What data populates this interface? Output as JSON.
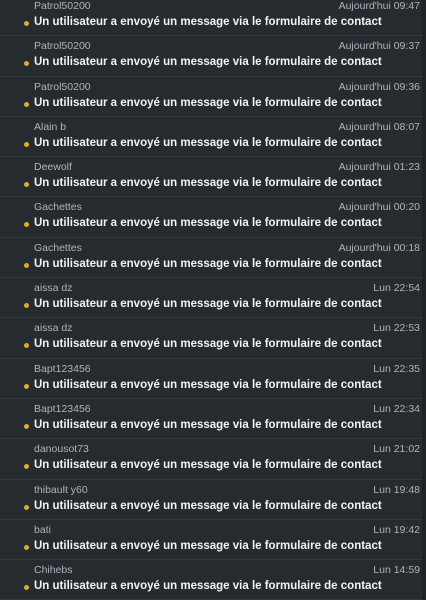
{
  "notifications": [
    {
      "sender": "Patrol50200",
      "time": "Aujourd'hui 09:47",
      "subject": "Un utilisateur a envoyé un message via le formulaire de contact"
    },
    {
      "sender": "Patrol50200",
      "time": "Aujourd'hui 09:37",
      "subject": "Un utilisateur a envoyé un message via le formulaire de contact"
    },
    {
      "sender": "Patrol50200",
      "time": "Aujourd'hui 09:36",
      "subject": "Un utilisateur a envoyé un message via le formulaire de contact"
    },
    {
      "sender": "Alain b",
      "time": "Aujourd'hui 08:07",
      "subject": "Un utilisateur a envoyé un message via le formulaire de contact"
    },
    {
      "sender": "Deewolf",
      "time": "Aujourd'hui 01:23",
      "subject": "Un utilisateur a envoyé un message via le formulaire de contact"
    },
    {
      "sender": "Gachettes",
      "time": "Aujourd'hui 00:20",
      "subject": "Un utilisateur a envoyé un message via le formulaire de contact"
    },
    {
      "sender": "Gachettes",
      "time": "Aujourd'hui 00:18",
      "subject": "Un utilisateur a envoyé un message via le formulaire de contact"
    },
    {
      "sender": "aissa dz",
      "time": "Lun 22:54",
      "subject": "Un utilisateur a envoyé un message via le formulaire de contact"
    },
    {
      "sender": "aissa dz",
      "time": "Lun 22:53",
      "subject": "Un utilisateur a envoyé un message via le formulaire de contact"
    },
    {
      "sender": "Bapt123456",
      "time": "Lun 22:35",
      "subject": "Un utilisateur a envoyé un message via le formulaire de contact"
    },
    {
      "sender": "Bapt123456",
      "time": "Lun 22:34",
      "subject": "Un utilisateur a envoyé un message via le formulaire de contact"
    },
    {
      "sender": "danousot73",
      "time": "Lun 21:02",
      "subject": "Un utilisateur a envoyé un message via le formulaire de contact"
    },
    {
      "sender": "thibault y60",
      "time": "Lun 19:48",
      "subject": "Un utilisateur a envoyé un message via le formulaire de contact"
    },
    {
      "sender": "bati",
      "time": "Lun 19:42",
      "subject": "Un utilisateur a envoyé un message via le formulaire de contact"
    },
    {
      "sender": "Chihebs",
      "time": "Lun 14:59",
      "subject": "Un utilisateur a envoyé un message via le formulaire de contact"
    }
  ],
  "colors": {
    "background": "#262b30",
    "unread_dot": "#e3a92e",
    "subject_text": "#f1f3f5",
    "meta_text": "#aeb4ba"
  },
  "icons": {
    "unread_marker": "unread-dot-icon"
  }
}
